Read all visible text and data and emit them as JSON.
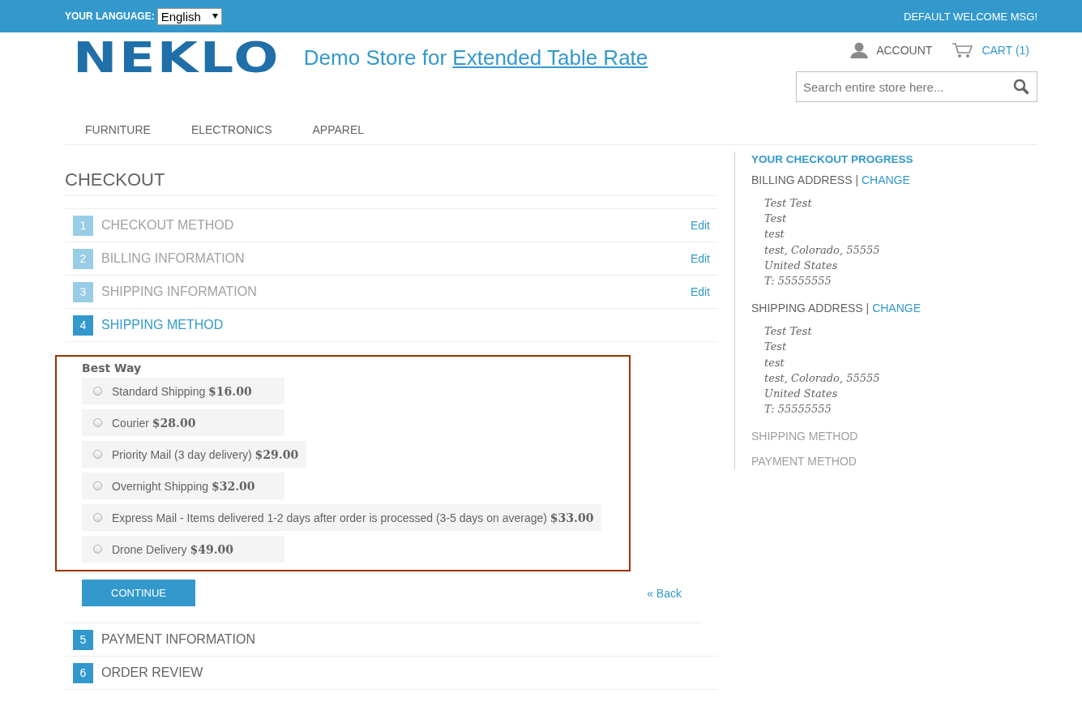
{
  "top_bar": {
    "language_label": "YOUR LANGUAGE:",
    "language_value": "English",
    "welcome": "DEFAULT WELCOME MSG!"
  },
  "header": {
    "logo": "NEKLO",
    "tagline": "Demo Store for",
    "tagline_link": "Extended Table Rate",
    "account": "ACCOUNT",
    "cart": "CART (1)",
    "search_placeholder": "Search entire store here..."
  },
  "nav": [
    "FURNITURE",
    "ELECTRONICS",
    "APPAREL"
  ],
  "checkout": {
    "title": "CHECKOUT",
    "steps": [
      {
        "number": "1",
        "label": "CHECKOUT METHOD",
        "kind": "complete",
        "edit": "Edit"
      },
      {
        "number": "2",
        "label": "BILLING INFORMATION",
        "kind": "complete",
        "edit": "Edit"
      },
      {
        "number": "3",
        "label": "SHIPPING INFORMATION",
        "kind": "complete",
        "edit": "Edit"
      },
      {
        "number": "4",
        "label": "SHIPPING METHOD",
        "kind": "active"
      },
      {
        "number": "5",
        "label": "PAYMENT INFORMATION",
        "kind": "upcoming"
      },
      {
        "number": "6",
        "label": "ORDER REVIEW",
        "kind": "upcoming"
      }
    ],
    "shipping_method": {
      "carrier": "Best Way",
      "options": [
        {
          "label": "Standard Shipping",
          "price": "$16.00",
          "selected": false
        },
        {
          "label": "Courier",
          "price": "$28.00",
          "selected": false
        },
        {
          "label": "Priority Mail (3 day delivery)",
          "price": "$29.00",
          "selected": false
        },
        {
          "label": "Overnight Shipping",
          "price": "$32.00",
          "selected": false
        },
        {
          "label": "Express Mail - Items delivered 1-2 days after order is processed (3-5 days on average)",
          "price": "$33.00",
          "selected": false
        },
        {
          "label": "Drone Delivery",
          "price": "$49.00",
          "selected": false
        }
      ],
      "continue": "CONTINUE",
      "back": "« Back"
    }
  },
  "sidebar": {
    "title": "YOUR CHECKOUT PROGRESS",
    "sections": [
      {
        "title": "BILLING ADDRESS",
        "separator": "|",
        "change": "CHANGE",
        "lines": [
          "Test Test",
          "Test",
          "test",
          "test, Colorado, 55555",
          "United States",
          "T: 55555555"
        ]
      },
      {
        "title": "SHIPPING ADDRESS",
        "separator": "|",
        "change": "CHANGE",
        "lines": [
          "Test Test",
          "Test",
          "test",
          "test, Colorado, 55555",
          "United States",
          "T: 55555555"
        ]
      },
      {
        "title": "SHIPPING METHOD"
      },
      {
        "title": "PAYMENT METHOD"
      }
    ]
  }
}
